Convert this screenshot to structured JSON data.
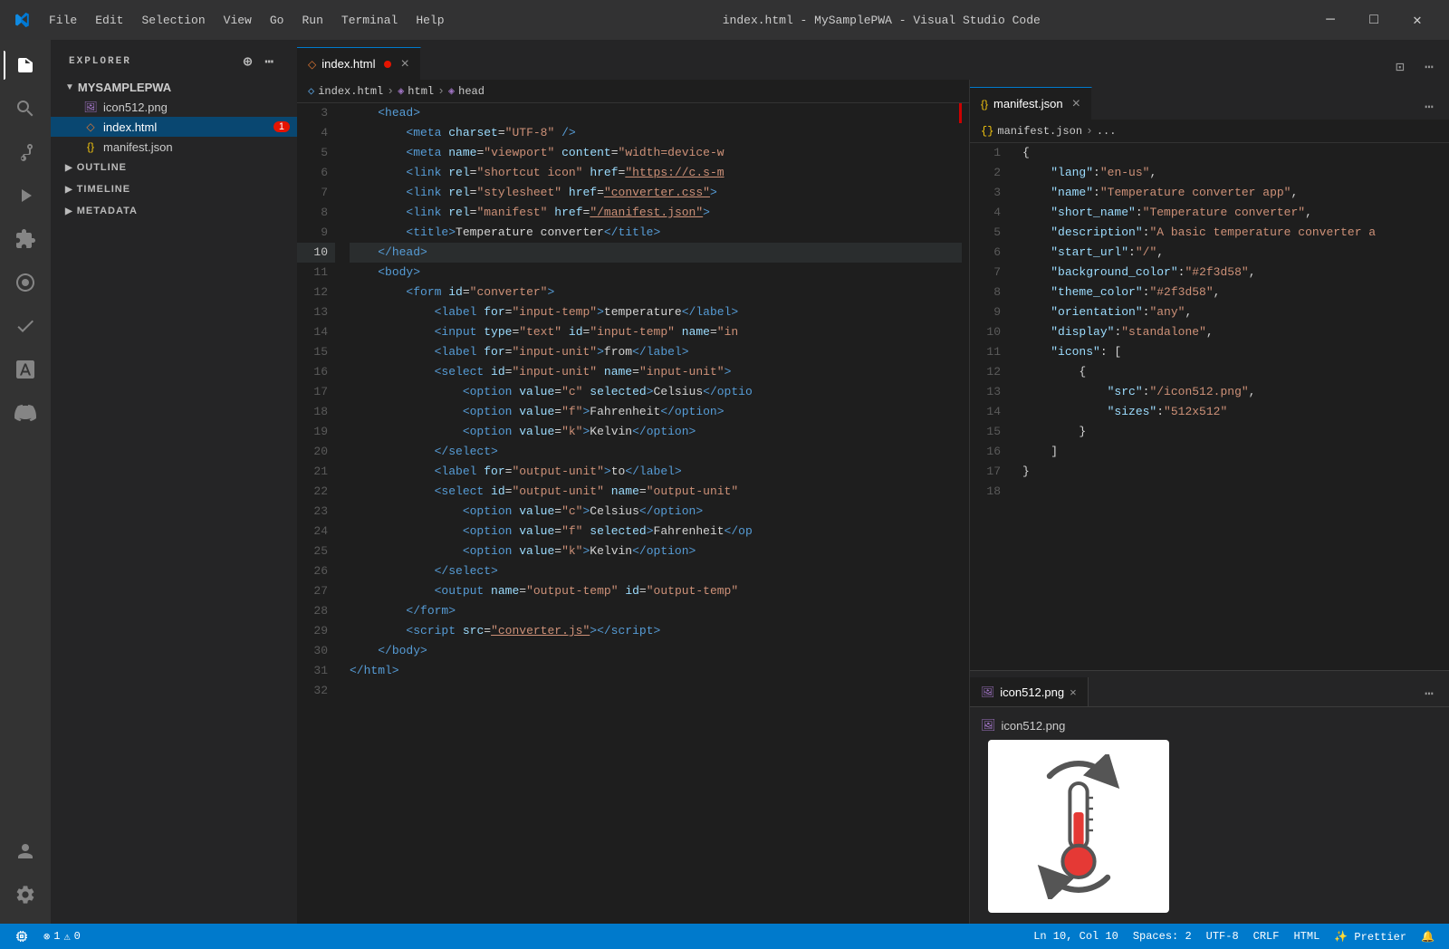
{
  "titlebar": {
    "title": "index.html - MySamplePWA - Visual Studio Code",
    "menu_items": [
      "File",
      "Edit",
      "Selection",
      "View",
      "Go",
      "Run",
      "Terminal",
      "Help"
    ],
    "min_label": "─",
    "max_label": "□",
    "close_label": "✕"
  },
  "activity_bar": {
    "icons": [
      {
        "name": "explorer-icon",
        "symbol": "⊞",
        "active": true
      },
      {
        "name": "search-icon",
        "symbol": "🔍",
        "active": false
      },
      {
        "name": "source-control-icon",
        "symbol": "⑂",
        "active": false
      },
      {
        "name": "run-debug-icon",
        "symbol": "▷",
        "active": false
      },
      {
        "name": "extensions-icon",
        "symbol": "⊡",
        "active": false
      },
      {
        "name": "remote-icon",
        "symbol": "◯",
        "active": false
      },
      {
        "name": "testing-icon",
        "symbol": "✓",
        "active": false
      },
      {
        "name": "font-icon",
        "symbol": "A",
        "active": false
      },
      {
        "name": "discord-icon",
        "symbol": "●",
        "active": false
      }
    ],
    "bottom_icons": [
      {
        "name": "account-icon",
        "symbol": "👤"
      },
      {
        "name": "settings-icon",
        "symbol": "⚙"
      }
    ]
  },
  "sidebar": {
    "header": "EXPLORER",
    "folder_name": "MYSAMPLEPWA",
    "files": [
      {
        "name": "icon512.png",
        "icon": "🖼",
        "color": "#a074c4",
        "active": false,
        "badge": null
      },
      {
        "name": "index.html",
        "icon": "◇",
        "color": "#e37933",
        "active": true,
        "badge": "1"
      },
      {
        "name": "manifest.json",
        "icon": "{}",
        "color": "#f1c40f",
        "active": false,
        "badge": null
      }
    ],
    "sections": [
      "OUTLINE",
      "TIMELINE",
      "METADATA"
    ]
  },
  "editor": {
    "tabs": [
      {
        "label": "index.html",
        "icon": "◇",
        "icon_color": "#e37933",
        "active": true,
        "dirty": true,
        "close": "×"
      },
      {
        "label": "manifest.json",
        "icon": "{}",
        "icon_color": "#f1c40f",
        "active": false,
        "dirty": false,
        "close": "×"
      }
    ],
    "breadcrumb": [
      {
        "label": "index.html",
        "icon": "◇"
      },
      {
        "label": "html",
        "icon": "◈"
      },
      {
        "label": "head",
        "icon": "◈"
      }
    ],
    "lines": [
      {
        "num": 3,
        "content": "<span class='t-text'>    </span><span class='t-tag'>&lt;head&gt;</span>",
        "current": false
      },
      {
        "num": 4,
        "content": "<span class='t-text'>        </span><span class='t-tag'>&lt;meta</span> <span class='t-attr'>charset</span><span class='t-eq'>=</span><span class='t-val'>&quot;UTF-8&quot;</span> <span class='t-tag'>/&gt;</span>",
        "current": false
      },
      {
        "num": 5,
        "content": "<span class='t-text'>        </span><span class='t-tag'>&lt;meta</span> <span class='t-attr'>name</span><span class='t-eq'>=</span><span class='t-val'>&quot;viewport&quot;</span> <span class='t-attr'>content</span><span class='t-eq'>=</span><span class='t-val'>&quot;width=device-w</span>",
        "current": false
      },
      {
        "num": 6,
        "content": "<span class='t-text'>        </span><span class='t-tag'>&lt;link</span> <span class='t-attr'>rel</span><span class='t-eq'>=</span><span class='t-val'>&quot;shortcut icon&quot;</span> <span class='t-attr'>href</span><span class='t-eq'>=</span><span class='t-link'>&quot;https://c.s-m</span>",
        "current": false
      },
      {
        "num": 7,
        "content": "<span class='t-text'>        </span><span class='t-tag'>&lt;link</span> <span class='t-attr'>rel</span><span class='t-eq'>=</span><span class='t-val'>&quot;stylesheet&quot;</span> <span class='t-attr'>href</span><span class='t-eq'>=</span><span class='t-link'>&quot;converter.css&quot;</span><span class='t-tag'>&gt;</span>...",
        "current": false
      },
      {
        "num": 8,
        "content": "<span class='t-text'>        </span><span class='t-tag'>&lt;link</span> <span class='t-attr'>rel</span><span class='t-eq'>=</span><span class='t-val'>&quot;manifest&quot;</span> <span class='t-attr'>href</span><span class='t-eq'>=</span><span class='t-link'>&quot;/manifest.json&quot;</span><span class='t-tag'>&gt;</span>",
        "current": false
      },
      {
        "num": 9,
        "content": "<span class='t-text'>        </span><span class='t-tag'>&lt;title&gt;</span><span class='t-text'>Temperature converter</span><span class='t-tag'>&lt;/title&gt;</span>",
        "current": false
      },
      {
        "num": 10,
        "content": "<span class='t-text'>    </span><span class='t-tag'>&lt;/head&gt;</span>",
        "current": true
      },
      {
        "num": 11,
        "content": "<span class='t-text'>    </span><span class='t-tag'>&lt;body&gt;</span>",
        "current": false
      },
      {
        "num": 12,
        "content": "<span class='t-text'>        </span><span class='t-tag'>&lt;form</span> <span class='t-attr'>id</span><span class='t-eq'>=</span><span class='t-val'>&quot;converter&quot;</span><span class='t-tag'>&gt;</span>",
        "current": false
      },
      {
        "num": 13,
        "content": "<span class='t-text'>            </span><span class='t-tag'>&lt;label</span> <span class='t-attr'>for</span><span class='t-eq'>=</span><span class='t-val'>&quot;input-temp&quot;</span><span class='t-tag'>&gt;</span><span class='t-text'>temperature</span><span class='t-tag'>&lt;/label&gt;</span>",
        "current": false
      },
      {
        "num": 14,
        "content": "<span class='t-text'>            </span><span class='t-tag'>&lt;input</span> <span class='t-attr'>type</span><span class='t-eq'>=</span><span class='t-val'>&quot;text&quot;</span> <span class='t-attr'>id</span><span class='t-eq'>=</span><span class='t-val'>&quot;input-temp&quot;</span> <span class='t-attr'>name</span><span class='t-eq'>=</span><span class='t-val'>&quot;in</span>",
        "current": false
      },
      {
        "num": 15,
        "content": "<span class='t-text'>            </span><span class='t-tag'>&lt;label</span> <span class='t-attr'>for</span><span class='t-eq'>=</span><span class='t-val'>&quot;input-unit&quot;</span><span class='t-tag'>&gt;</span><span class='t-text'>from</span><span class='t-tag'>&lt;/label&gt;</span>",
        "current": false
      },
      {
        "num": 16,
        "content": "<span class='t-text'>            </span><span class='t-tag'>&lt;select</span> <span class='t-attr'>id</span><span class='t-eq'>=</span><span class='t-val'>&quot;input-unit&quot;</span> <span class='t-attr'>name</span><span class='t-eq'>=</span><span class='t-val'>&quot;input-unit&quot;</span><span class='t-tag'>&gt;</span>",
        "current": false
      },
      {
        "num": 17,
        "content": "<span class='t-text'>                </span><span class='t-tag'>&lt;option</span> <span class='t-attr'>value</span><span class='t-eq'>=</span><span class='t-val'>&quot;c&quot;</span> <span class='t-attr'>selected</span><span class='t-tag'>&gt;</span><span class='t-text'>Celsius</span><span class='t-tag'>&lt;/optio</span>",
        "current": false
      },
      {
        "num": 18,
        "content": "<span class='t-text'>                </span><span class='t-tag'>&lt;option</span> <span class='t-attr'>value</span><span class='t-eq'>=</span><span class='t-val'>&quot;f&quot;</span><span class='t-tag'>&gt;</span><span class='t-text'>Fahrenheit</span><span class='t-tag'>&lt;/option&gt;</span>",
        "current": false
      },
      {
        "num": 19,
        "content": "<span class='t-text'>                </span><span class='t-tag'>&lt;option</span> <span class='t-attr'>value</span><span class='t-eq'>=</span><span class='t-val'>&quot;k&quot;</span><span class='t-tag'>&gt;</span><span class='t-text'>Kelvin</span><span class='t-tag'>&lt;/option&gt;</span>",
        "current": false
      },
      {
        "num": 20,
        "content": "<span class='t-text'>            </span><span class='t-tag'>&lt;/select&gt;</span>",
        "current": false
      },
      {
        "num": 21,
        "content": "<span class='t-text'>            </span><span class='t-tag'>&lt;label</span> <span class='t-attr'>for</span><span class='t-eq'>=</span><span class='t-val'>&quot;output-unit&quot;</span><span class='t-tag'>&gt;</span><span class='t-text'>to</span><span class='t-tag'>&lt;/label&gt;</span>",
        "current": false
      },
      {
        "num": 22,
        "content": "<span class='t-text'>            </span><span class='t-tag'>&lt;select</span> <span class='t-attr'>id</span><span class='t-eq'>=</span><span class='t-val'>&quot;output-unit&quot;</span> <span class='t-attr'>name</span><span class='t-eq'>=</span><span class='t-val'>&quot;output-unit&quot;</span>",
        "current": false
      },
      {
        "num": 23,
        "content": "<span class='t-text'>                </span><span class='t-tag'>&lt;option</span> <span class='t-attr'>value</span><span class='t-eq'>=</span><span class='t-val'>&quot;c&quot;</span><span class='t-tag'>&gt;</span><span class='t-text'>Celsius</span><span class='t-tag'>&lt;/option&gt;</span>",
        "current": false
      },
      {
        "num": 24,
        "content": "<span class='t-text'>                </span><span class='t-tag'>&lt;option</span> <span class='t-attr'>value</span><span class='t-eq'>=</span><span class='t-val'>&quot;f&quot;</span> <span class='t-attr'>selected</span><span class='t-tag'>&gt;</span><span class='t-text'>Fahrenheit</span><span class='t-tag'>&lt;/op</span>",
        "current": false
      },
      {
        "num": 25,
        "content": "<span class='t-text'>                </span><span class='t-tag'>&lt;option</span> <span class='t-attr'>value</span><span class='t-eq'>=</span><span class='t-val'>&quot;k&quot;</span><span class='t-tag'>&gt;</span><span class='t-text'>Kelvin</span><span class='t-tag'>&lt;/option&gt;</span>",
        "current": false
      },
      {
        "num": 26,
        "content": "<span class='t-text'>            </span><span class='t-tag'>&lt;/select&gt;</span>",
        "current": false
      },
      {
        "num": 27,
        "content": "<span class='t-text'>            </span><span class='t-tag'>&lt;output</span> <span class='t-attr'>name</span><span class='t-eq'>=</span><span class='t-val'>&quot;output-temp&quot;</span> <span class='t-attr'>id</span><span class='t-eq'>=</span><span class='t-val'>&quot;output-temp&quot;</span>",
        "current": false
      },
      {
        "num": 28,
        "content": "<span class='t-text'>        </span><span class='t-tag'>&lt;/form&gt;</span>",
        "current": false
      },
      {
        "num": 29,
        "content": "<span class='t-text'>        </span><span class='t-tag'>&lt;script</span> <span class='t-attr'>src</span><span class='t-eq'>=</span><span class='t-link'>&quot;converter.js&quot;</span><span class='t-tag'>&gt;&lt;/script&gt;</span>",
        "current": false
      },
      {
        "num": 30,
        "content": "<span class='t-text'>    </span><span class='t-tag'>&lt;/body&gt;</span>",
        "current": false
      },
      {
        "num": 31,
        "content": "<span class='t-tag'>&lt;/html&gt;</span>",
        "current": false
      },
      {
        "num": 32,
        "content": "",
        "current": false
      }
    ]
  },
  "manifest_editor": {
    "tab_label": "manifest.json",
    "tab_close": "×",
    "breadcrumb": [
      "manifest.json",
      "..."
    ],
    "lines": [
      {
        "num": 1,
        "content": "<span class='t-text'>{</span>"
      },
      {
        "num": 2,
        "content": "<span class='t-text'>    </span><span class='t-key'>&quot;lang&quot;</span><span class='t-text'>: </span><span class='t-str'>&quot;en-us&quot;</span><span class='t-text'>,</span>"
      },
      {
        "num": 3,
        "content": "<span class='t-text'>    </span><span class='t-key'>&quot;name&quot;</span><span class='t-text'>: </span><span class='t-str'>&quot;Temperature converter app&quot;</span><span class='t-text'>,</span>"
      },
      {
        "num": 4,
        "content": "<span class='t-text'>    </span><span class='t-key'>&quot;short_name&quot;</span><span class='t-text'>: </span><span class='t-str'>&quot;Temperature converter&quot;</span><span class='t-text'>,</span>"
      },
      {
        "num": 5,
        "content": "<span class='t-text'>    </span><span class='t-key'>&quot;description&quot;</span><span class='t-text'>: </span><span class='t-str'>&quot;A basic temperature converter a</span>"
      },
      {
        "num": 6,
        "content": "<span class='t-text'>    </span><span class='t-key'>&quot;start_url&quot;</span><span class='t-text'>: </span><span class='t-str'>&quot;/&quot;</span><span class='t-text'>,</span>"
      },
      {
        "num": 7,
        "content": "<span class='t-text'>    </span><span class='t-key'>&quot;background_color&quot;</span><span class='t-text'>: </span><span class='t-str'>&quot;#2f3d58&quot;</span><span class='t-text'>,</span>"
      },
      {
        "num": 8,
        "content": "<span class='t-text'>    </span><span class='t-key'>&quot;theme_color&quot;</span><span class='t-text'>: </span><span class='t-str'>&quot;#2f3d58&quot;</span><span class='t-text'>,</span>"
      },
      {
        "num": 9,
        "content": "<span class='t-text'>    </span><span class='t-key'>&quot;orientation&quot;</span><span class='t-text'>: </span><span class='t-str'>&quot;any&quot;</span><span class='t-text'>,</span>"
      },
      {
        "num": 10,
        "content": "<span class='t-text'>    </span><span class='t-key'>&quot;display&quot;</span><span class='t-text'>: </span><span class='t-str'>&quot;standalone&quot;</span><span class='t-text'>,</span>"
      },
      {
        "num": 11,
        "content": "<span class='t-text'>    </span><span class='t-key'>&quot;icons&quot;</span><span class='t-text'>: [</span>"
      },
      {
        "num": 12,
        "content": "<span class='t-text'>        {</span>"
      },
      {
        "num": 13,
        "content": "<span class='t-text'>            </span><span class='t-key'>&quot;src&quot;</span><span class='t-text'>: </span><span class='t-str'>&quot;/icon512.png&quot;</span><span class='t-text'>,</span>"
      },
      {
        "num": 14,
        "content": "<span class='t-text'>            </span><span class='t-key'>&quot;sizes&quot;</span><span class='t-text'>: </span><span class='t-str'>&quot;512x512&quot;</span>"
      },
      {
        "num": 15,
        "content": "<span class='t-text'>        }</span>"
      },
      {
        "num": 16,
        "content": "<span class='t-text'>    ]</span>"
      },
      {
        "num": 17,
        "content": "<span class='t-text'>}</span>"
      },
      {
        "num": 18,
        "content": ""
      }
    ]
  },
  "icon_preview": {
    "tab_label": "icon512.png",
    "tab_close": "×",
    "filename": "icon512.png"
  },
  "status_bar": {
    "left": [
      {
        "icon": "⊞",
        "text": ""
      },
      {
        "icon": "⚠",
        "text": "1"
      },
      {
        "icon": "⊗",
        "text": "0"
      }
    ],
    "right_items": [
      "Ln 10, Col 10",
      "Spaces: 2",
      "UTF-8",
      "CRLF",
      "HTML",
      "✨ Prettier",
      "🔔"
    ]
  }
}
